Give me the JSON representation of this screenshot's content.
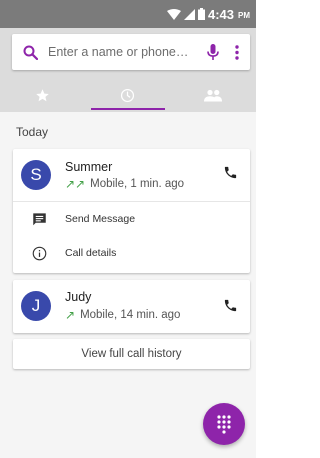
{
  "status_bar": {
    "time": "4:43",
    "ampm": "PM"
  },
  "search": {
    "placeholder": "Enter a name or phone…"
  },
  "tabs": [
    {
      "name": "favorites",
      "icon": "star-icon"
    },
    {
      "name": "recents",
      "icon": "clock-icon",
      "active": true
    },
    {
      "name": "contacts",
      "icon": "people-icon"
    }
  ],
  "section": {
    "title": "Today"
  },
  "calls": [
    {
      "initial": "S",
      "name": "Summer",
      "detail": "Mobile, 1 min. ago",
      "arrows": "↗↗"
    },
    {
      "initial": "J",
      "name": "Judy",
      "detail": "Mobile, 14 min. ago",
      "arrows": "↗"
    }
  ],
  "actions": {
    "send_message": "Send Message",
    "call_details": "Call details"
  },
  "history": {
    "label": "View full call history"
  },
  "colors": {
    "accent": "#8e24aa",
    "avatar": "#3949ab",
    "outgoing": "#43a047"
  }
}
